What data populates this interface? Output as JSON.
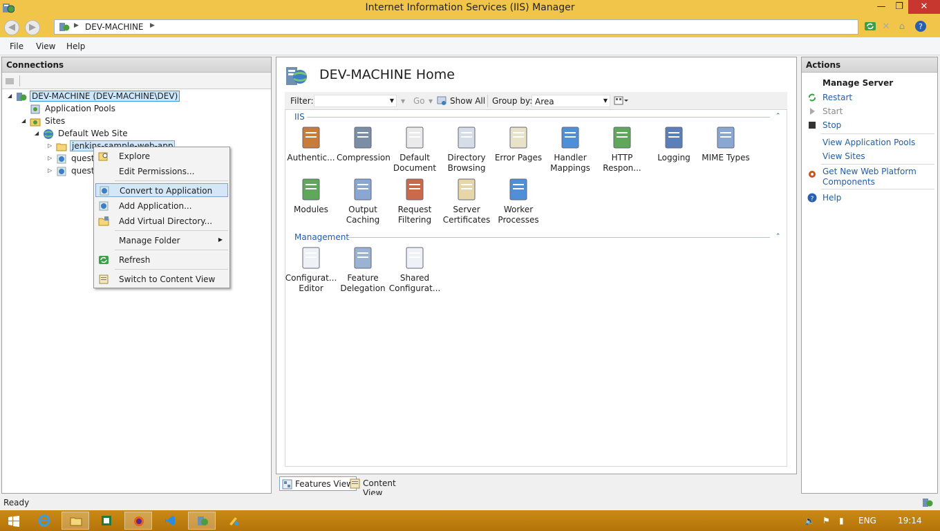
{
  "window": {
    "title": "Internet Information Services (IIS) Manager",
    "minimize": "—",
    "maximize": "❐",
    "close": "✕"
  },
  "address": {
    "crumb": "DEV-MACHINE",
    "sep": "▶"
  },
  "menu": [
    "File",
    "View",
    "Help"
  ],
  "connections": {
    "title": "Connections",
    "tree": [
      {
        "label": "DEV-MACHINE (DEV-MACHINE\\DEV)",
        "expander": "◢"
      },
      {
        "label": "Application Pools",
        "expander": ""
      },
      {
        "label": "Sites",
        "expander": "◢"
      },
      {
        "label": "Default Web Site",
        "expander": "◢"
      },
      {
        "label": "jenkins-sample-web-app",
        "expander": "▷"
      },
      {
        "label": "questi",
        "expander": "▷"
      },
      {
        "label": "questi",
        "expander": "▷"
      }
    ]
  },
  "context_menu": {
    "items": [
      "Explore",
      "Edit Permissions...",
      "Convert to Application",
      "Add Application...",
      "Add Virtual Directory...",
      "Manage Folder",
      "Refresh",
      "Switch to Content View"
    ],
    "submenu_arrow": "▶"
  },
  "center": {
    "title": "DEV-MACHINE Home",
    "filter_label": "Filter:",
    "go_label": "Go",
    "show_all_label": "Show All",
    "group_by_label": "Group by:",
    "group_by_value": "Area",
    "groups": [
      {
        "name": "IIS",
        "features": [
          [
            "Authentic..."
          ],
          [
            "Compression"
          ],
          [
            "Default",
            "Document"
          ],
          [
            "Directory",
            "Browsing"
          ],
          [
            "Error Pages"
          ],
          [
            "Handler",
            "Mappings"
          ],
          [
            "HTTP",
            "Respon..."
          ],
          [
            "Logging"
          ],
          [
            "MIME Types"
          ],
          [
            "Modules"
          ],
          [
            "Output",
            "Caching"
          ],
          [
            "Request",
            "Filtering"
          ],
          [
            "Server",
            "Certificates"
          ],
          [
            "Worker",
            "Processes"
          ]
        ]
      },
      {
        "name": "Management",
        "features": [
          [
            "Configurat...",
            "Editor"
          ],
          [
            "Feature",
            "Delegation"
          ],
          [
            "Shared",
            "Configurat..."
          ]
        ]
      }
    ],
    "collapse_glyph": "⌃"
  },
  "view_tabs": {
    "features": "Features View",
    "content": "Content View"
  },
  "actions": {
    "title": "Actions",
    "section": "Manage Server",
    "items": [
      "Restart",
      "Start",
      "Stop",
      "View Application Pools",
      "View Sites",
      "Get New Web Platform",
      "Components",
      "Help"
    ]
  },
  "status": {
    "text": "Ready"
  },
  "taskbar": {
    "lang": "ENG",
    "time": "19:14"
  }
}
